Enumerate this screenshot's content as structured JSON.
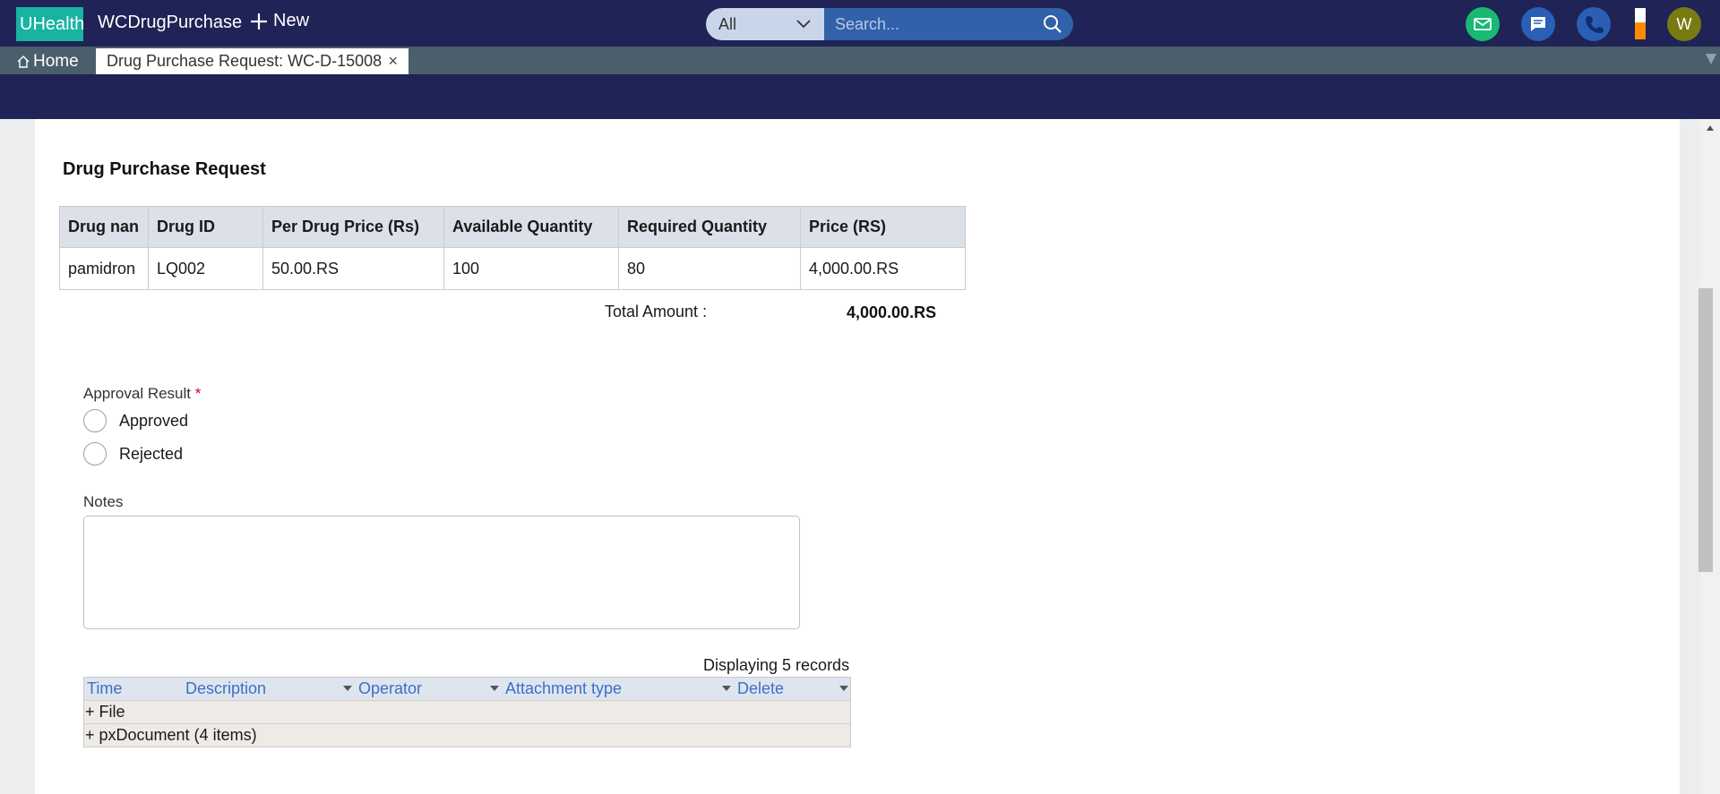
{
  "header": {
    "logo_text": "UHealth",
    "app_title": "WCDrugPurchase",
    "new_label": "New",
    "search_scope": "All",
    "search_placeholder": "Search...",
    "avatar_initial": "W",
    "status_level_percent": 55,
    "colors": {
      "bar": "#1f2355",
      "logo": "#17b3a3",
      "mail": "#19b873",
      "chat": "#2a5fb5",
      "status": "#ff8c00",
      "avatar": "#7a7a13"
    }
  },
  "tabs": {
    "home_label": "Home",
    "active_tab_label": "Drug Purchase Request: WC-D-15008",
    "close_glyph": "×"
  },
  "form": {
    "section_title": "Drug Purchase Request",
    "table": {
      "headers": [
        "Drug nan",
        "Drug ID",
        "Per Drug Price (Rs)",
        "Available Quantity",
        "Required Quantity",
        "Price (RS)"
      ],
      "rows": [
        [
          "pamidron",
          "LQ002",
          "50.00.RS",
          "100",
          "80",
          "4,000.00.RS"
        ]
      ]
    },
    "total_label": "Total Amount :",
    "total_value": "4,000.00.RS",
    "approval_label": "Approval Result",
    "required_marker": "*",
    "approval_options": [
      "Approved",
      "Rejected"
    ],
    "notes_label": "Notes",
    "notes_value": ""
  },
  "attachments": {
    "records_text": "Displaying 5 records",
    "columns": [
      "Time",
      "Description",
      "Operator",
      "Attachment type",
      "Delete"
    ],
    "groups": [
      "+ File",
      "+ pxDocument (4 items)"
    ]
  }
}
